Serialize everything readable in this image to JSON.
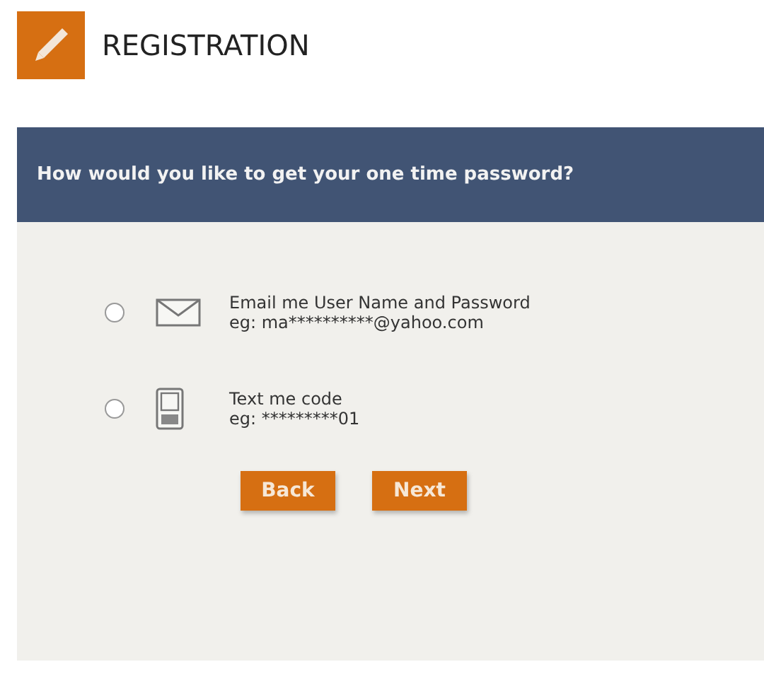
{
  "header": {
    "title": "REGISTRATION"
  },
  "prompt": "How would you like to get your one time password?",
  "options": [
    {
      "kind": "email",
      "label": "Email me User Name and Password",
      "example": "eg: ma**********@yahoo.com",
      "selected": false
    },
    {
      "kind": "phone",
      "label": "Text me code",
      "example": "eg: *********01",
      "selected": false
    }
  ],
  "buttons": [
    "Back",
    "Next"
  ]
}
